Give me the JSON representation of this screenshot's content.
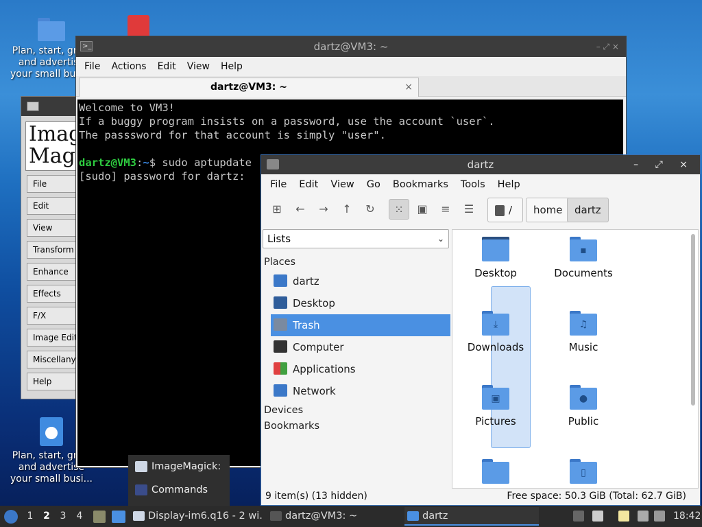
{
  "desktop": {
    "icons": [
      {
        "label": "Plan, start, grow and advertise your small busi...",
        "kind": "folder-icon"
      },
      {
        "label": "Plan, start, grow and advertise your small busi...",
        "kind": "globe-doc-icon"
      }
    ]
  },
  "imagemagick": {
    "logo_text": "Imag\nMag",
    "buttons": [
      "File",
      "Edit",
      "View",
      "Transform",
      "Enhance",
      "Effects",
      "F/X",
      "Image Edit",
      "Miscellany",
      "Help"
    ]
  },
  "terminal": {
    "title": "dartz@VM3: ~",
    "title_icon": ">_",
    "window_controls": "–  ⤢  ×",
    "menu": [
      "File",
      "Actions",
      "Edit",
      "View",
      "Help"
    ],
    "tab_title": "dartz@VM3: ~",
    "tab_close": "×",
    "lines": {
      "l1": "Welcome to VM3!",
      "l2": "If a buggy program insists on a password, use the account `user`.",
      "l3": "The passsword for that account is simply \"user\".",
      "prompt_user": "dartz@VM3",
      "prompt_sep": ":",
      "prompt_path": "~",
      "prompt_cmd": "$ sudo aptupdate",
      "l5": "[sudo] password for dartz: "
    }
  },
  "file_manager": {
    "title": "dartz",
    "window_controls": "– ⤢ ×",
    "menu": [
      "File",
      "Edit",
      "View",
      "Go",
      "Bookmarks",
      "Tools",
      "Help"
    ],
    "toolbar_icons": [
      "new-tab-icon",
      "back-icon",
      "forward-icon",
      "up-icon",
      "reload-icon",
      "icon-view-icon",
      "thumbnail-view-icon",
      "compact-view-icon",
      "detailed-view-icon"
    ],
    "breadcrumbs": [
      "/",
      "home",
      "dartz"
    ],
    "sidebar_mode": "Lists",
    "places_header": "Places",
    "places": [
      {
        "label": "dartz",
        "color": "#3b78c8"
      },
      {
        "label": "Desktop",
        "color": "#2f5d9a"
      },
      {
        "label": "Trash",
        "color": "#7a8aa0"
      },
      {
        "label": "Computer",
        "color": "#333333"
      },
      {
        "label": "Applications",
        "color": "#e07030"
      },
      {
        "label": "Network",
        "color": "#3b78c8"
      }
    ],
    "devices_header": "Devices",
    "bookmarks_header": "Bookmarks",
    "items": [
      {
        "label": "Desktop",
        "glyph": ""
      },
      {
        "label": "Documents",
        "glyph": "▪"
      },
      {
        "label": "Downloads",
        "glyph": "⤓"
      },
      {
        "label": "Music",
        "glyph": "♫"
      },
      {
        "label": "Pictures",
        "glyph": "▣"
      },
      {
        "label": "Public",
        "glyph": "●"
      },
      {
        "label": "",
        "glyph": ""
      },
      {
        "label": "",
        "glyph": "▯"
      }
    ],
    "status_left": "9 item(s) (13 hidden)",
    "status_right": "Free space: 50.3 GiB (Total: 62.7 GiB)"
  },
  "popup": {
    "items": [
      "ImageMagick:",
      "Commands"
    ]
  },
  "taskbar": {
    "workspaces": [
      "1",
      "2",
      "3",
      "4"
    ],
    "current_workspace": "2",
    "tasks": [
      "Display-im6.q16 - 2 wi...",
      "dartz@VM3: ~",
      "dartz"
    ],
    "clock": "18:42"
  }
}
